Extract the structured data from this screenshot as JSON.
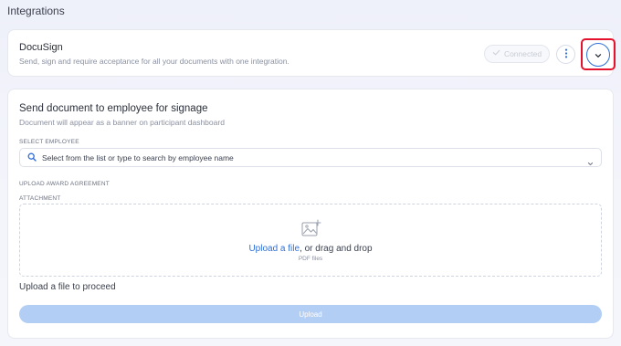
{
  "page": {
    "title": "Integrations"
  },
  "integration": {
    "name": "DocuSign",
    "description": "Send, sign and require acceptance for all your documents with one integration.",
    "status_label": "Connected"
  },
  "form": {
    "title": "Send document to employee for signage",
    "subtitle": "Document will appear as a banner on participant dashboard",
    "select_employee_label": "SELECT EMPLOYEE",
    "select_employee_placeholder": "Select from the list or type to search by employee name",
    "upload_section_label": "UPLOAD AWARD AGREEMENT",
    "attachment_label": "ATTACHMENT",
    "upload_link": "Upload a file",
    "upload_rest": ", or drag and drop",
    "file_hint": "PDF files",
    "proceed_text": "Upload a file to proceed",
    "upload_button": "Upload"
  },
  "colors": {
    "accent": "#2f6fd6",
    "highlight": "#e4122d",
    "upload_button_disabled": "#b3cef5"
  },
  "icons": [
    "check-icon",
    "more-vertical-icon",
    "chevron-down-icon",
    "search-icon",
    "image-add-icon"
  ]
}
